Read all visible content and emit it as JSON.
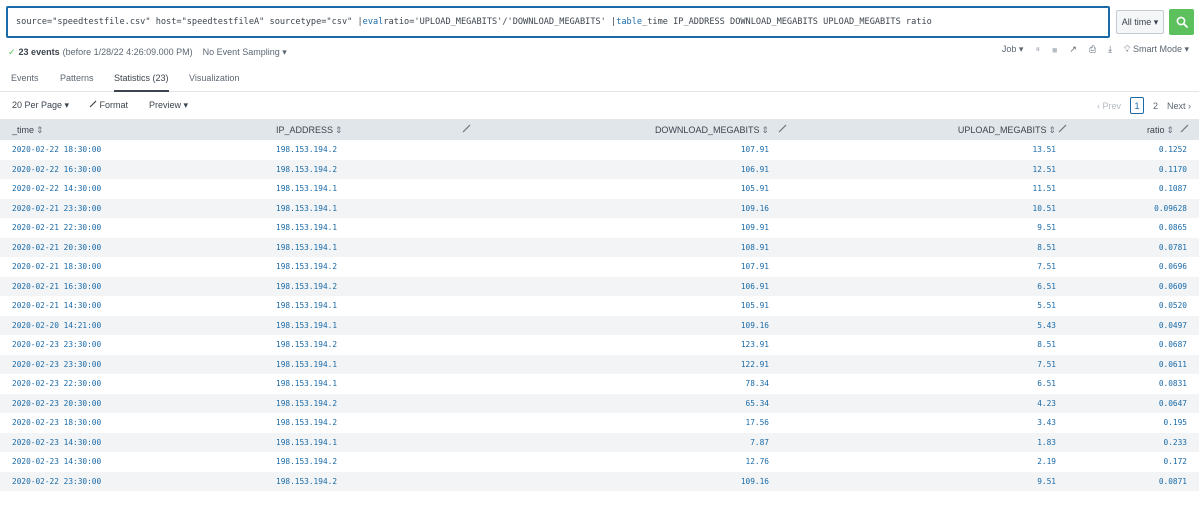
{
  "search": {
    "part1": "source=\"speedtestfile.csv\" host=\"speedtestfileA\" sourcetype=\"csv\" | ",
    "kw_eval": "eval",
    "part2": " ratio='UPLOAD_MEGABITS'/'DOWNLOAD_MEGABITS' | ",
    "kw_table": "table",
    "part3": " _time IP_ADDRESS DOWNLOAD_MEGABITS UPLOAD_MEGABITS ratio",
    "time_range": "All time ▾"
  },
  "status": {
    "events_count": "23 events",
    "events_detail": "(before 1/28/22 4:26:09.000 PM)",
    "sampling": "No Event Sampling ▾",
    "job": "Job ▾",
    "mode": "Smart Mode ▾"
  },
  "tabs": [
    "Events",
    "Patterns",
    "Statistics (23)",
    "Visualization"
  ],
  "toolbar": {
    "per_page": "20 Per Page ▾",
    "format": "Format",
    "preview": "Preview ▾"
  },
  "pager": {
    "prev": "‹ Prev",
    "page1": "1",
    "page2": "2",
    "next": "Next ›"
  },
  "columns": {
    "time": "_time",
    "ip": "IP_ADDRESS",
    "download": "DOWNLOAD_MEGABITS",
    "upload": "UPLOAD_MEGABITS",
    "ratio": "ratio"
  },
  "rows": [
    [
      "2020-02-22 18:30:00",
      "198.153.194.2",
      "107.91",
      "13.51",
      "0.1252"
    ],
    [
      "2020-02-22 16:30:00",
      "198.153.194.2",
      "106.91",
      "12.51",
      "0.1170"
    ],
    [
      "2020-02-22 14:30:00",
      "198.153.194.1",
      "105.91",
      "11.51",
      "0.1087"
    ],
    [
      "2020-02-21 23:30:00",
      "198.153.194.1",
      "109.16",
      "10.51",
      "0.09628"
    ],
    [
      "2020-02-21 22:30:00",
      "198.153.194.1",
      "109.91",
      "9.51",
      "0.0865"
    ],
    [
      "2020-02-21 20:30:00",
      "198.153.194.1",
      "108.91",
      "8.51",
      "0.0781"
    ],
    [
      "2020-02-21 18:30:00",
      "198.153.194.2",
      "107.91",
      "7.51",
      "0.0696"
    ],
    [
      "2020-02-21 16:30:00",
      "198.153.194.2",
      "106.91",
      "6.51",
      "0.0609"
    ],
    [
      "2020-02-21 14:30:00",
      "198.153.194.1",
      "105.91",
      "5.51",
      "0.0520"
    ],
    [
      "2020-02-20 14:21:00",
      "198.153.194.1",
      "109.16",
      "5.43",
      "0.0497"
    ],
    [
      "2020-02-23 23:30:00",
      "198.153.194.2",
      "123.91",
      "8.51",
      "0.0687"
    ],
    [
      "2020-02-23 23:30:00",
      "198.153.194.1",
      "122.91",
      "7.51",
      "0.0611"
    ],
    [
      "2020-02-23 22:30:00",
      "198.153.194.1",
      "78.34",
      "6.51",
      "0.0831"
    ],
    [
      "2020-02-23 20:30:00",
      "198.153.194.2",
      "65.34",
      "4.23",
      "0.0647"
    ],
    [
      "2020-02-23 18:30:00",
      "198.153.194.2",
      "17.56",
      "3.43",
      "0.195"
    ],
    [
      "2020-02-23 14:30:00",
      "198.153.194.1",
      "7.87",
      "1.83",
      "0.233"
    ],
    [
      "2020-02-23 14:30:00",
      "198.153.194.2",
      "12.76",
      "2.19",
      "0.172"
    ],
    [
      "2020-02-22 23:30:00",
      "198.153.194.2",
      "109.16",
      "9.51",
      "0.0871"
    ]
  ],
  "colors": {
    "accent": "#1a6aa8",
    "search_button": "#5cc05c",
    "header_bg": "#e1e6eb",
    "row_alt": "#f2f4f5"
  }
}
